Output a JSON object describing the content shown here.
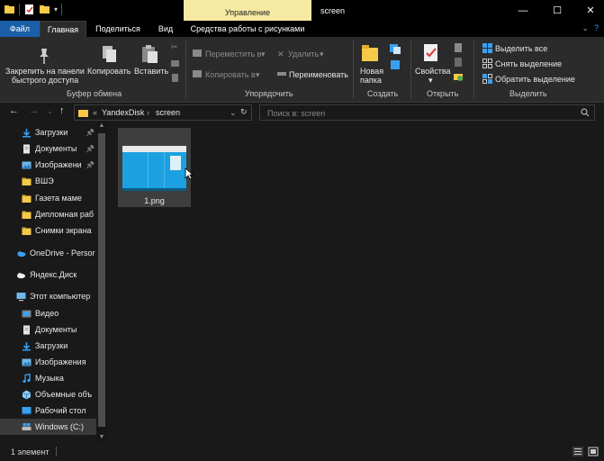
{
  "window": {
    "title": "screen",
    "contextual_tab": "Управление",
    "minimize_icon": "minimize-icon",
    "maximize_icon": "maximize-icon",
    "close_icon": "close-icon"
  },
  "tabs": [
    {
      "label": "Файл"
    },
    {
      "label": "Главная"
    },
    {
      "label": "Поделиться"
    },
    {
      "label": "Вид"
    },
    {
      "label": "Средства работы с рисунками"
    }
  ],
  "ribbon": {
    "clipboard": {
      "pin_label": "Закрепить на панели быстрого доступа",
      "copy_label": "Копировать",
      "paste_label": "Вставить",
      "group_label": "Буфер обмена"
    },
    "organize": {
      "move_label": "Переместить в",
      "copy_to_label": "Копировать в",
      "delete_label": "Удалить",
      "rename_label": "Переименовать",
      "group_label": "Упорядочить"
    },
    "create": {
      "new_folder_label": "Новая папка",
      "group_label": "Создать"
    },
    "open": {
      "properties_label": "Свойства",
      "group_label": "Открыть"
    },
    "select": {
      "select_all_label": "Выделить все",
      "select_none_label": "Снять выделение",
      "invert_label": "Обратить выделение",
      "group_label": "Выделить"
    }
  },
  "address": {
    "overflow": "«",
    "crumbs": [
      "YandexDisk",
      "screen"
    ],
    "search_placeholder": "Поиск в: screen"
  },
  "nav_pane": {
    "items": [
      {
        "label": "Загрузки",
        "icon": "download-icon",
        "pinned": true
      },
      {
        "label": "Документы",
        "icon": "documents-icon",
        "pinned": true
      },
      {
        "label": "Изображени",
        "icon": "pictures-icon",
        "pinned": true
      },
      {
        "label": "ВШЭ",
        "icon": "folder-icon",
        "pinned": false
      },
      {
        "label": "Газета маме",
        "icon": "folder-icon",
        "pinned": false
      },
      {
        "label": "Дипломная раб",
        "icon": "folder-icon",
        "pinned": false
      },
      {
        "label": "Снимки экрана",
        "icon": "folder-icon",
        "pinned": false
      },
      {
        "label": "OneDrive - Persor",
        "icon": "onedrive-icon",
        "pinned": false
      },
      {
        "label": "Яндекс.Диск",
        "icon": "yandex-disk-icon",
        "pinned": false
      },
      {
        "label": "Этот компьютер",
        "icon": "computer-icon",
        "pinned": false
      },
      {
        "label": "Видео",
        "icon": "video-icon",
        "pinned": false
      },
      {
        "label": "Документы",
        "icon": "documents-icon",
        "pinned": false
      },
      {
        "label": "Загрузки",
        "icon": "download-icon",
        "pinned": false
      },
      {
        "label": "Изображения",
        "icon": "pictures-icon",
        "pinned": false
      },
      {
        "label": "Музыка",
        "icon": "music-icon",
        "pinned": false
      },
      {
        "label": "Объемные объ",
        "icon": "3d-objects-icon",
        "pinned": false
      },
      {
        "label": "Рабочий стол",
        "icon": "desktop-icon",
        "pinned": false
      },
      {
        "label": "Windows (C:)",
        "icon": "drive-icon",
        "pinned": false,
        "selected": true
      }
    ]
  },
  "files": [
    {
      "name": "1.png",
      "icon": "image-thumbnail"
    }
  ],
  "status": {
    "count_text": "1 элемент"
  },
  "colors": {
    "background": "#191919",
    "ribbon": "#2b2b2b",
    "file_tab": "#1a5fa8",
    "contextual_tab": "#f6e9a2",
    "folder": "#f7c948",
    "accent_blue": "#3a9ff0"
  }
}
